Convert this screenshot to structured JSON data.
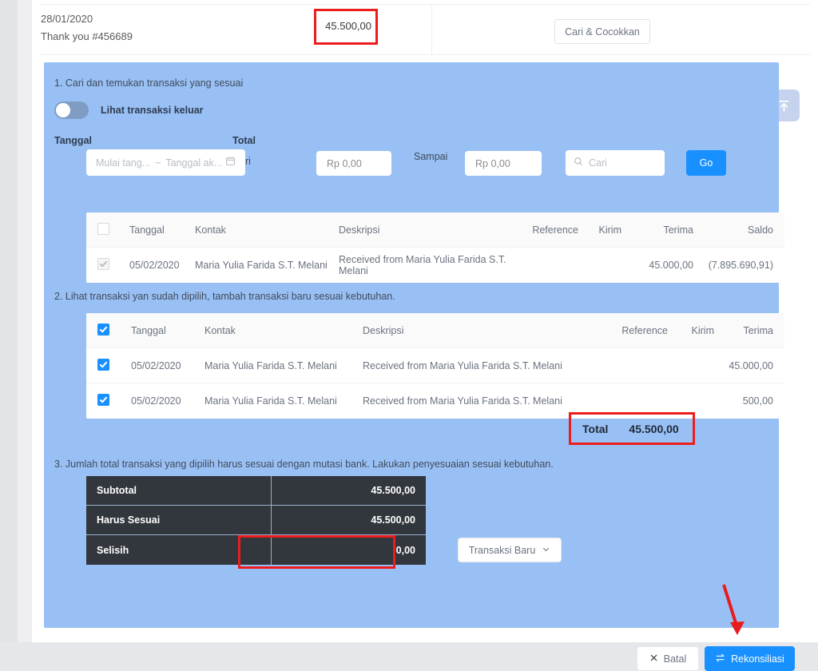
{
  "statement": {
    "date": "28/01/2020",
    "description": "Thank you #456689",
    "amount": "45.500,00",
    "match_button": "Cari & Cocokkan"
  },
  "float_button": {
    "icon": "scroll-to-top-icon"
  },
  "panel": {
    "step1": {
      "title": "1. Cari dan temukan transaksi yang sesuai",
      "toggle_label": "Lihat transaksi keluar",
      "toggle_on": false,
      "label_tanggal": "Tanggal",
      "label_total": "Total",
      "label_dari": "Dari",
      "label_sampai": "Sampai",
      "date_start_placeholder": "Mulai tang...",
      "date_separator": "~",
      "date_end_placeholder": "Tanggal ak...",
      "amount_from_placeholder": "Rp 0,00",
      "amount_to_placeholder": "Rp 0,00",
      "search_placeholder": "Cari",
      "go_label": "Go"
    },
    "table1": {
      "headers": [
        "Tanggal",
        "Kontak",
        "Deskripsi",
        "Reference",
        "Kirim",
        "Terima",
        "Saldo"
      ],
      "rows": [
        {
          "checked": true,
          "disabled": true,
          "tanggal": "05/02/2020",
          "kontak": "Maria Yulia Farida S.T. Melani",
          "deskripsi": "Received from Maria Yulia Farida S.T. Melani",
          "reference": "",
          "kirim": "",
          "terima": "45.000,00",
          "saldo": "(7.895.690,91)"
        }
      ]
    },
    "step2": {
      "title": "2. Lihat transaksi yan sudah dipilih, tambah transaksi baru sesuai kebutuhan."
    },
    "table2": {
      "header_checked": true,
      "headers": [
        "Tanggal",
        "Kontak",
        "Deskripsi",
        "Reference",
        "Kirim",
        "Terima"
      ],
      "rows": [
        {
          "checked": true,
          "tanggal": "05/02/2020",
          "kontak": "Maria Yulia Farida S.T. Melani",
          "deskripsi": "Received from Maria Yulia Farida S.T. Melani",
          "reference": "",
          "kirim": "",
          "terima": "45.000,00"
        },
        {
          "checked": true,
          "tanggal": "05/02/2020",
          "kontak": "Maria Yulia Farida S.T. Melani",
          "deskripsi": "Received from Maria Yulia Farida S.T. Melani",
          "reference": "",
          "kirim": "",
          "terima": "500,00"
        }
      ],
      "total_label": "Total",
      "total_value": "45.500,00"
    },
    "step3": {
      "title": "3. Jumlah total transaksi yang dipilih harus sesuai dengan mutasi bank. Lakukan penyesuaian sesuai kebutuhan.",
      "summary": [
        {
          "label": "Subtotal",
          "value": "45.500,00"
        },
        {
          "label": "Harus Sesuai",
          "value": "45.500,00"
        },
        {
          "label": "Selisih",
          "value": "0,00"
        }
      ],
      "new_transaction_label": "Transaksi Baru"
    },
    "footer": {
      "cancel_label": "Batal",
      "reconcile_label": "Rekonsiliasi"
    }
  },
  "colors": {
    "panel_blue": "#99c0f5",
    "primary_blue": "#1890ff",
    "highlight_red": "#ee1c1c",
    "dark_table": "#32363d"
  }
}
